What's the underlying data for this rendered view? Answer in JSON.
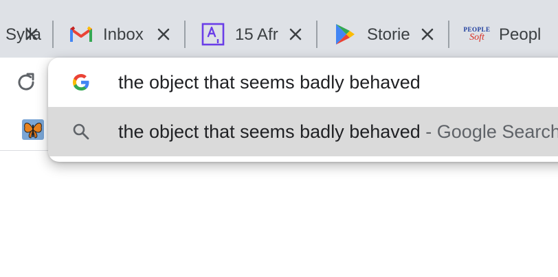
{
  "tabs": [
    {
      "title": "Sylla",
      "icon": "doc-icon"
    },
    {
      "title": "Inbox",
      "icon": "gmail-icon"
    },
    {
      "title": "15 Afr",
      "icon": "a-box-icon"
    },
    {
      "title": "Storie",
      "icon": "play-store-icon"
    },
    {
      "title": "Peopl",
      "icon": "peoplesoft-icon",
      "favicon_text_top": "PEOPLE",
      "favicon_text_bottom": "Soft"
    }
  ],
  "omnibox": {
    "input_value": "the object that seems badly behaved",
    "suggestion_text": "the object that seems badly behaved",
    "suggestion_suffix": " - Google Search"
  },
  "colors": {
    "tabstrip": "#dee1e6",
    "highlight": "#dadada",
    "google_blue": "#4285f4",
    "google_red": "#ea4335",
    "google_yellow": "#fbbc05",
    "google_green": "#34a853",
    "accent_purple": "#6a3de8"
  }
}
